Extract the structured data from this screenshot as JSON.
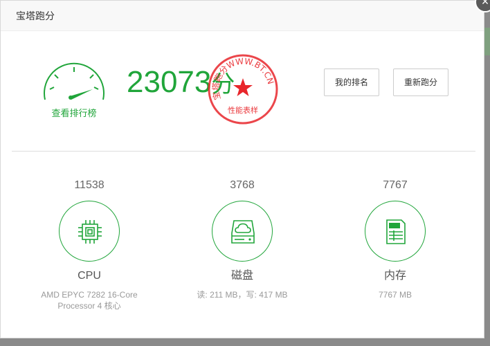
{
  "dialog": {
    "title": "宝塔跑分",
    "close_symbol": "×"
  },
  "summary": {
    "total_score": "23073",
    "unit": "分",
    "leaderboard_link": "查看排行榜",
    "gauge_icon": "speedometer-icon"
  },
  "seal": {
    "ring_text": "宝塔跑分WWW.BT.CN",
    "bottom_text": "性能表样",
    "color": "#e8262b"
  },
  "actions": {
    "my_rank_label": "我的排名",
    "retest_label": "重新跑分"
  },
  "metrics": [
    {
      "score": "11538",
      "name": "CPU",
      "detail": "AMD EPYC 7282 16-Core Processor 4 核心",
      "icon": "cpu-chip-icon"
    },
    {
      "score": "3768",
      "name": "磁盘",
      "detail": "读: 211 MB，写: 417 MB",
      "icon": "cloud-disk-icon"
    },
    {
      "score": "7767",
      "name": "内存",
      "detail": "7767 MB",
      "icon": "memory-card-icon"
    }
  ],
  "colors": {
    "accent": "#20a53a",
    "seal_red": "#e8262b"
  }
}
